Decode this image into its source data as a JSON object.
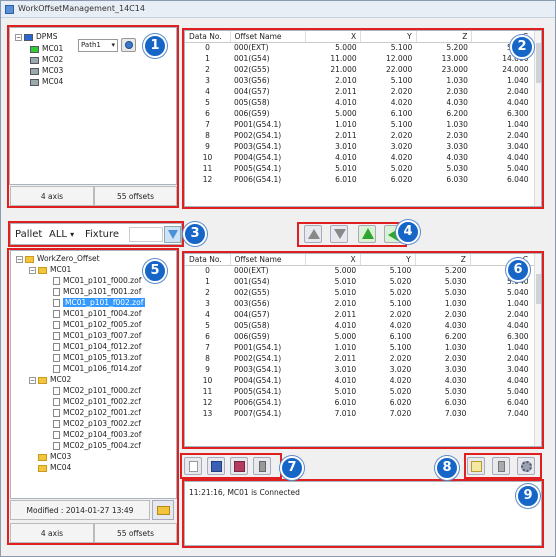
{
  "window": {
    "title": "WorkOffsetManagement_14C14"
  },
  "machines": {
    "root": "DPMS",
    "items": [
      "MC01",
      "MC02",
      "MC03",
      "MC04"
    ],
    "path_select": "Path1",
    "status_axis": "4 axis",
    "status_offsets": "55 offsets"
  },
  "filter": {
    "pallet_label": "Pallet",
    "pallet_value": "ALL",
    "fixture_label": "Fixture",
    "fixture_value": ""
  },
  "files": {
    "root": "WorkZero_Offset",
    "groups": [
      {
        "name": "MC01",
        "files": [
          "MC01_p101_f000.zof",
          "MC01_p101_f001.zof",
          "MC01_p101_f002.zof",
          "MC01_p101_f004.zof",
          "MC01_p102_f005.zof",
          "MC01_p103_f007.zof",
          "MC01_p104_f012.zof",
          "MC01_p105_f013.zof",
          "MC01_p106_f014.zof"
        ]
      },
      {
        "name": "MC02",
        "files": [
          "MC02_p101_f000.zcf",
          "MC02_p101_f002.zcf",
          "MC02_p102_f001.zcf",
          "MC02_p103_f002.zcf",
          "MC02_p104_f003.zof",
          "MC02_p105_f004.zcf"
        ]
      },
      {
        "name": "MC03",
        "files": []
      },
      {
        "name": "MC04",
        "files": []
      }
    ],
    "selected": "MC01_p101_f002.zof",
    "modified": "Modified : 2014-01-27 13:49",
    "status_axis": "4 axis",
    "status_offsets": "55 offsets"
  },
  "table_columns": [
    "Data No.",
    "Offset Name",
    "X",
    "Y",
    "Z",
    "C"
  ],
  "machine_table": [
    [
      "0",
      "000(EXT)",
      "5.000",
      "5.100",
      "5.200",
      "5.300"
    ],
    [
      "1",
      "001(G54)",
      "11.000",
      "12.000",
      "13.000",
      "14.000"
    ],
    [
      "2",
      "002(G55)",
      "21.000",
      "22.000",
      "23.000",
      "24.000"
    ],
    [
      "3",
      "003(G56)",
      "2.010",
      "5.100",
      "1.030",
      "1.040"
    ],
    [
      "4",
      "004(G57)",
      "2.011",
      "2.020",
      "2.030",
      "2.040"
    ],
    [
      "5",
      "005(G58)",
      "4.010",
      "4.020",
      "4.030",
      "4.040"
    ],
    [
      "6",
      "006(G59)",
      "5.000",
      "6.100",
      "6.200",
      "6.300"
    ],
    [
      "7",
      "P001(G54.1)",
      "1.010",
      "5.100",
      "1.030",
      "1.040"
    ],
    [
      "8",
      "P002(G54.1)",
      "2.011",
      "2.020",
      "2.030",
      "2.040"
    ],
    [
      "9",
      "P003(G54.1)",
      "3.010",
      "3.020",
      "3.030",
      "3.040"
    ],
    [
      "10",
      "P004(G54.1)",
      "4.010",
      "4.020",
      "4.030",
      "4.040"
    ],
    [
      "11",
      "P005(G54.1)",
      "5.010",
      "5.020",
      "5.030",
      "5.040"
    ],
    [
      "12",
      "P006(G54.1)",
      "6.010",
      "6.020",
      "6.030",
      "6.040"
    ]
  ],
  "file_table": [
    [
      "0",
      "000(EXT)",
      "5.000",
      "5.100",
      "5.200",
      "5.300"
    ],
    [
      "1",
      "001(G54)",
      "5.010",
      "5.020",
      "5.030",
      "5.040"
    ],
    [
      "2",
      "002(G55)",
      "5.010",
      "5.020",
      "5.030",
      "5.040"
    ],
    [
      "3",
      "003(G56)",
      "2.010",
      "5.100",
      "1.030",
      "1.040"
    ],
    [
      "4",
      "004(G57)",
      "2.011",
      "2.020",
      "2.030",
      "2.040"
    ],
    [
      "5",
      "005(G58)",
      "4.010",
      "4.020",
      "4.030",
      "4.040"
    ],
    [
      "6",
      "006(G59)",
      "5.000",
      "6.100",
      "6.200",
      "6.300"
    ],
    [
      "7",
      "P001(G54.1)",
      "1.010",
      "5.100",
      "1.030",
      "1.040"
    ],
    [
      "8",
      "P002(G54.1)",
      "2.011",
      "2.020",
      "2.030",
      "2.040"
    ],
    [
      "9",
      "P003(G54.1)",
      "3.010",
      "3.020",
      "3.030",
      "3.040"
    ],
    [
      "10",
      "P004(G54.1)",
      "4.010",
      "4.020",
      "4.030",
      "4.040"
    ],
    [
      "11",
      "P005(G54.1)",
      "5.010",
      "5.020",
      "5.030",
      "5.040"
    ],
    [
      "12",
      "P006(G54.1)",
      "6.010",
      "6.020",
      "6.030",
      "6.040"
    ],
    [
      "13",
      "P007(G54.1)",
      "7.010",
      "7.020",
      "7.030",
      "7.040"
    ]
  ],
  "log": {
    "message": "11:21:16, MC01 is Connected"
  },
  "badges": [
    "1",
    "2",
    "3",
    "4",
    "5",
    "6",
    "7",
    "8",
    "9"
  ],
  "colors": {
    "badge": "#1666c7",
    "highlight": "#e02020",
    "selection": "#3399ff"
  }
}
